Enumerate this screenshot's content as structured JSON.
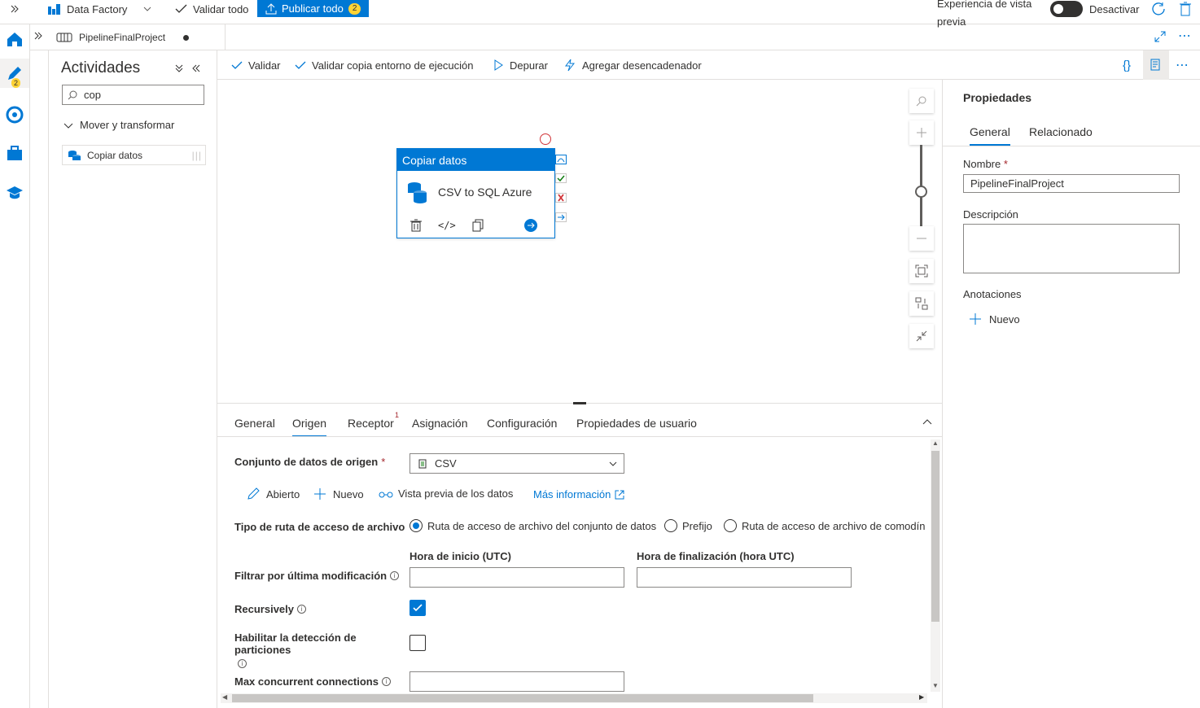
{
  "topbar": {
    "app_name": "Data Factory",
    "validate_all": "Validar todo",
    "publish_all": "Publicar todo",
    "publish_count": "2",
    "preview_experience": "Experiencia de vista previa",
    "toggle_label": "Desactivar"
  },
  "rail": {
    "author_badge": "2"
  },
  "tab": {
    "title": "PipelineFinalProject"
  },
  "activities": {
    "title": "Actividades",
    "search_value": "cop",
    "group": "Mover y transformar",
    "item": "Copiar datos"
  },
  "toolbar": {
    "validate": "Validar",
    "validate_copy": "Validar copia entorno de ejecución",
    "debug": "Depurar",
    "add_trigger": "Agregar desencadenador"
  },
  "card": {
    "header": "Copiar datos",
    "name": "CSV to SQL Azure"
  },
  "properties": {
    "title": "Propiedades",
    "tab_general": "General",
    "tab_related": "Relacionado",
    "name_label": "Nombre",
    "name_value": "PipelineFinalProject",
    "description_label": "Descripción",
    "annotations_label": "Anotaciones",
    "new_label": "Nuevo"
  },
  "bottom": {
    "tabs": [
      "General",
      "Origen",
      "Receptor",
      "Asignación",
      "Configuración",
      "Propiedades de usuario"
    ],
    "receptor_badge": "1",
    "source_dataset_label": "Conjunto de datos de origen",
    "source_dataset_value": "CSV",
    "open": "Abierto",
    "new": "Nuevo",
    "preview_data": "Vista previa de los datos",
    "more_info": "Más información",
    "path_type_label": "Tipo de ruta de acceso de archivo",
    "radio_dataset_path": "Ruta de acceso de archivo del conjunto de datos",
    "radio_prefix": "Prefijo",
    "radio_wildcard": "Ruta de acceso de archivo de comodín",
    "start_time_label": "Hora de inicio (UTC)",
    "end_time_label": "Hora de finalización (hora UTC)",
    "filter_label": "Filtrar por última modificación",
    "recursively_label": "Recursively",
    "recursively_checked": true,
    "partition_label": "Habilitar la detección de particiones",
    "partition_checked": false,
    "max_conn_label": "Max concurrent connections"
  },
  "colors": {
    "accent": "#0078d4",
    "error": "#d13438",
    "success": "#107c10"
  }
}
